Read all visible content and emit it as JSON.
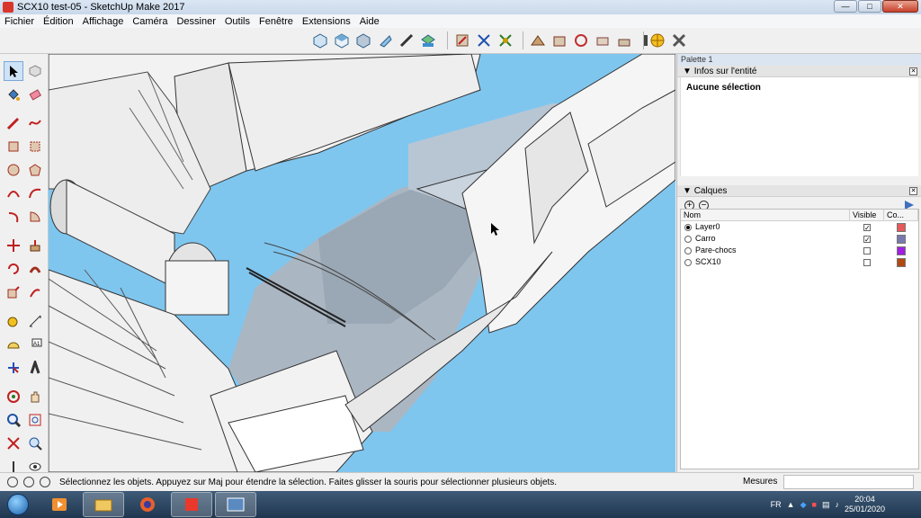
{
  "window": {
    "title": "SCX10 test-05 - SketchUp Make 2017"
  },
  "menu": [
    "Fichier",
    "Édition",
    "Affichage",
    "Caméra",
    "Dessiner",
    "Outils",
    "Fenêtre",
    "Extensions",
    "Aide"
  ],
  "tray": {
    "title": "Palette 1",
    "entity_info": {
      "title": "Infos sur l'entité",
      "selection": "Aucune sélection"
    },
    "layers": {
      "title": "Calques",
      "columns": [
        "Nom",
        "Visible",
        "Co..."
      ],
      "rows": [
        {
          "name": "Layer0",
          "active": true,
          "visible": true,
          "color": "#e85a5a"
        },
        {
          "name": "Carro",
          "active": false,
          "visible": true,
          "color": "#7a78b0"
        },
        {
          "name": "Pare-chocs",
          "active": false,
          "visible": false,
          "color": "#a020e0"
        },
        {
          "name": "SCX10",
          "active": false,
          "visible": false,
          "color": "#b04a10"
        }
      ]
    }
  },
  "status": {
    "message": "Sélectionnez les objets. Appuyez sur Maj pour étendre la sélection. Faites glisser la souris pour sélectionner plusieurs objets.",
    "measure_label": "Mesures"
  },
  "taskbar": {
    "lang": "FR",
    "time": "20:04",
    "date": "25/01/2020"
  },
  "colors": {
    "sky": "#7fc6ef",
    "model_face": "#f4f4f4",
    "inner_face": "#a9b4c0"
  }
}
